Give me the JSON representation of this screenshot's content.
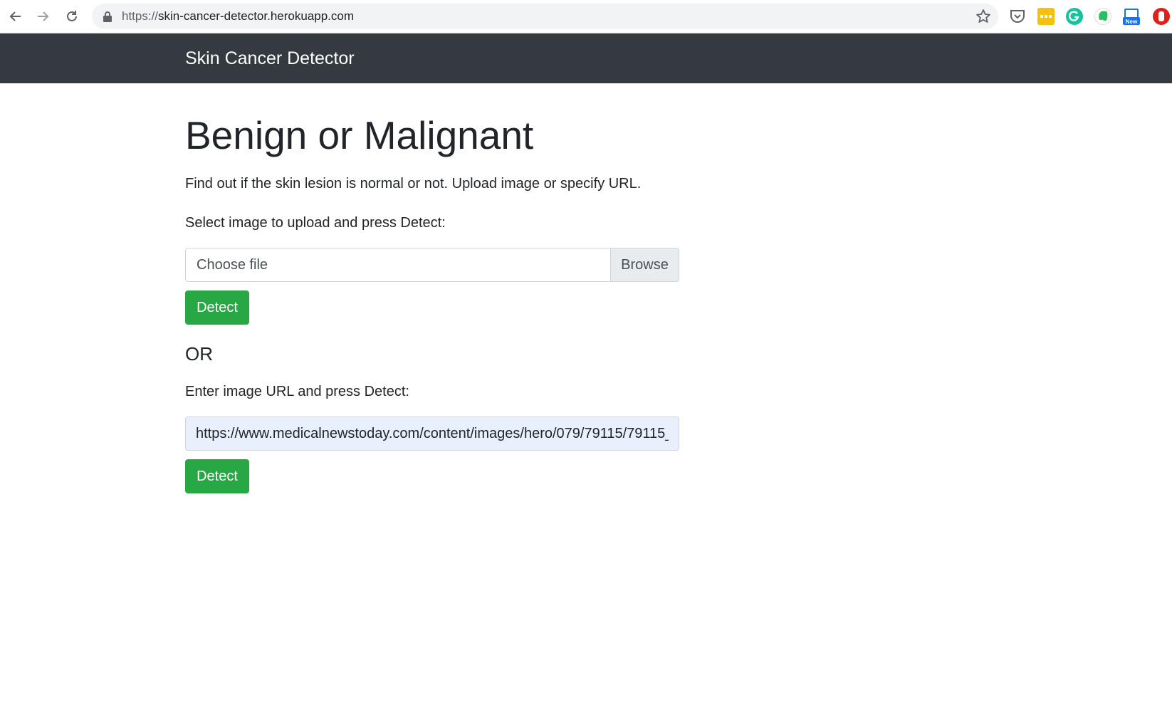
{
  "browser": {
    "url_prefix": "https://",
    "url_host": "skin-cancer-detector.herokuapp.com",
    "extensions": [
      "pocket-icon",
      "yellow-extension-icon",
      "grammarly-icon",
      "evernote-icon",
      "new-extension-icon",
      "adblock-icon"
    ],
    "new_badge": "New"
  },
  "navbar": {
    "brand": "Skin Cancer Detector",
    "background": "#343a40"
  },
  "main": {
    "title": "Benign or Malignant",
    "lead": "Find out if the skin lesion is normal or not. Upload image or specify URL.",
    "upload_label": "Select image to upload and press Detect:",
    "file_placeholder": "Choose file",
    "browse_label": "Browse",
    "detect_label": "Detect",
    "or_text": "OR",
    "url_label": "Enter image URL and press Detect:",
    "url_value": "https://www.medicalnewstoday.com/content/images/hero/079/79115/79115_"
  },
  "colors": {
    "accent_green": "#28a745",
    "autofill_blue": "#e8f0fe"
  }
}
